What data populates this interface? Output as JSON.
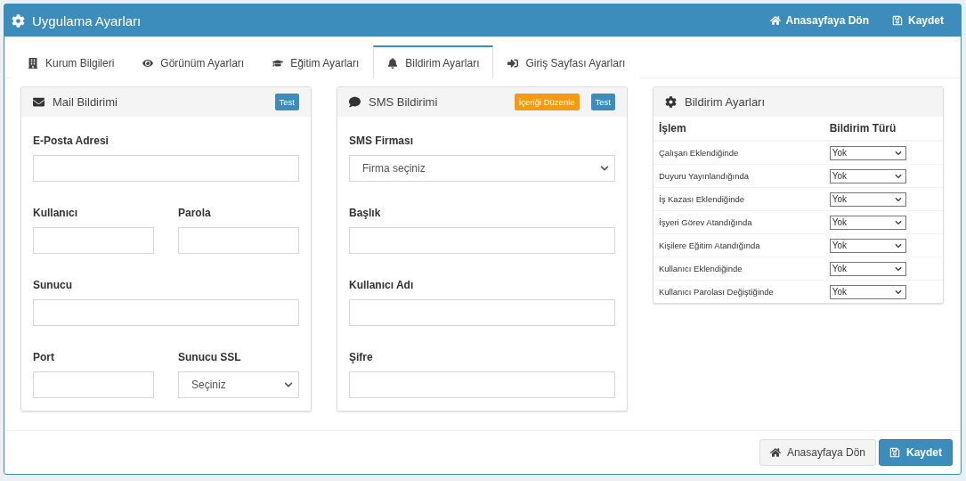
{
  "window": {
    "title": "Uygulama Ayarları",
    "actions": [
      {
        "kind": "home",
        "label": "Anasayfaya Dön"
      },
      {
        "kind": "save",
        "label": "Kaydet"
      }
    ]
  },
  "tabs": [
    {
      "label": "Kurum Bilgileri",
      "selected": false
    },
    {
      "label": "Görünüm Ayarları",
      "selected": false
    },
    {
      "label": "Eğitim Ayarları",
      "selected": false
    },
    {
      "label": "Bildirim Ayarları",
      "selected": true
    },
    {
      "label": "Giriş Sayfası Ayarları",
      "selected": false
    }
  ],
  "panels": [
    {
      "kind": "form",
      "title": "Mail Bildirimi",
      "buttons": [
        {
          "kind": "info",
          "label": "Test"
        }
      ],
      "rows": [
        [
          {
            "label": "E-Posta Adresi",
            "kind": "input"
          }
        ],
        [
          {
            "label": "Kullanıcı",
            "kind": "input"
          },
          {
            "label": "Parola",
            "kind": "input"
          }
        ],
        [
          {
            "label": "Sunucu",
            "kind": "input"
          }
        ],
        [
          {
            "label": "Port",
            "kind": "input"
          },
          {
            "label": "Sunucu SSL",
            "kind": "select",
            "value": "Seçiniz"
          }
        ]
      ]
    },
    {
      "kind": "form",
      "title": "SMS Bildirimi",
      "buttons": [
        {
          "kind": "warning",
          "label": "İçeriği Düzenle"
        },
        {
          "kind": "info",
          "label": "Test"
        }
      ],
      "rows": [
        [
          {
            "label": "SMS Firması",
            "kind": "select",
            "value": "Firma seçiniz"
          }
        ],
        [
          {
            "label": "Başlık",
            "kind": "input"
          }
        ],
        [
          {
            "label": "Kullanıcı Adı",
            "kind": "input"
          }
        ],
        [
          {
            "label": "Şifre",
            "kind": "input"
          }
        ]
      ]
    },
    {
      "kind": "table",
      "title": "Bildirim Ayarları",
      "columns": [
        "İşlem",
        "Bildirim Türü"
      ],
      "rows": [
        {
          "event": "Çalışan Eklendiğinde",
          "type": "Yok"
        },
        {
          "event": "Duyuru Yayınlandığında",
          "type": "Yok"
        },
        {
          "event": "İş Kazası Eklendiğinde",
          "type": "Yok"
        },
        {
          "event": "İşyeri Görev Atandığında",
          "type": "Yok"
        },
        {
          "event": "Kişilere Eğitim Atandığında",
          "type": "Yok"
        },
        {
          "event": "Kullanıcı Eklendiğinde",
          "type": "Yok"
        },
        {
          "event": "Kullanıcı Parolası Değiştiğinde",
          "type": "Yok"
        }
      ]
    }
  ],
  "footer": {
    "buttons": [
      {
        "kind": "home",
        "label": "Anasayfaya Dön"
      },
      {
        "kind": "save",
        "label": "Kaydet"
      }
    ]
  }
}
